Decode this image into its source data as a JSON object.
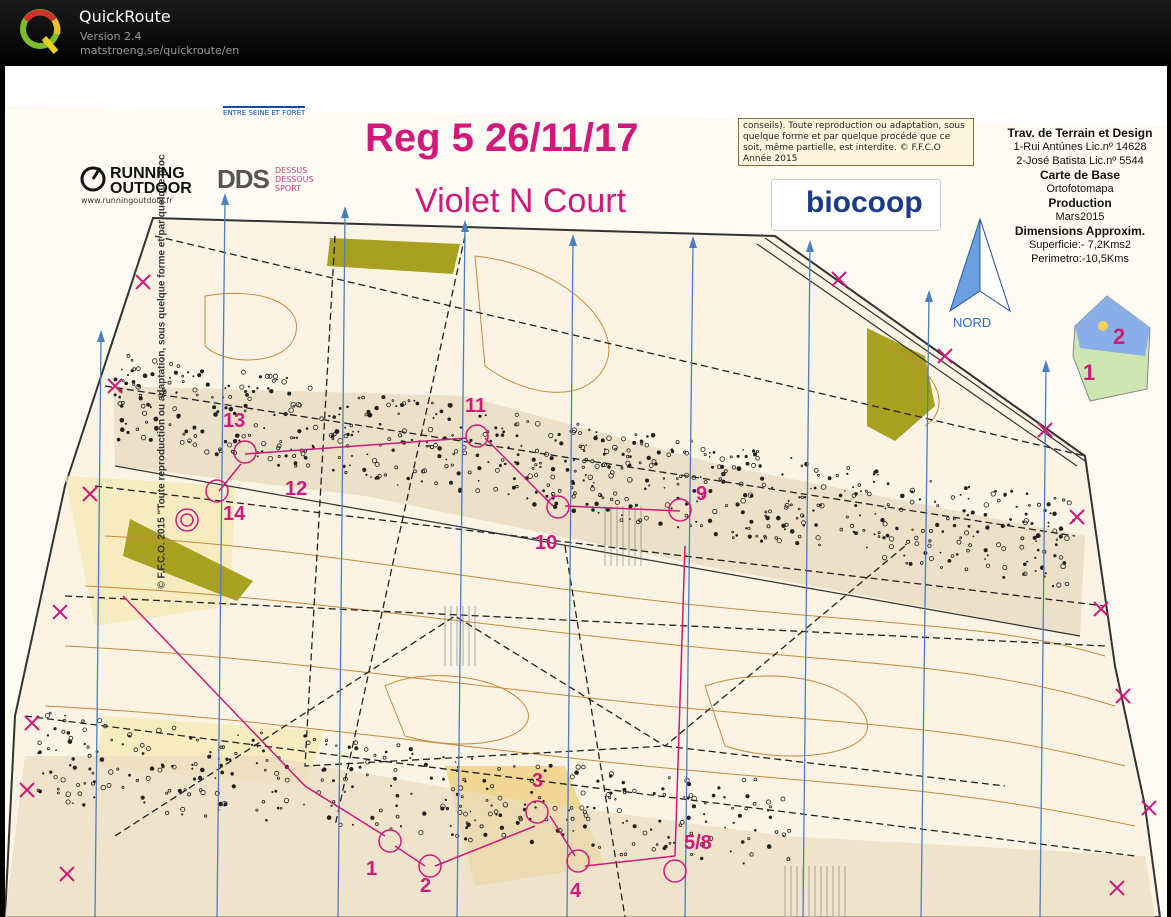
{
  "window": {
    "app_title": "QuickRoute",
    "version": "Version 2.4",
    "url": "matstroeng.se/quickroute/en"
  },
  "map": {
    "heading": "Reg 5  26/11/17",
    "course_name": "Violet N Court",
    "copyright_box": "conseils). Toute reproduction ou adaptation, sous quelque forme et par quelque procédé que ce soit, même partielle, est interdite. © F.F.C.O Année 2015",
    "side_copyright": "© F.F.C.O. 2015  \"Toute reproduction ou adaptation, sous quelque forme et par quelque proc",
    "sponsor_running": "RUNNING\nOUTDOOR",
    "sponsor_running_url": "www.runningoutdoor.fr",
    "sponsor_dds": "DDS",
    "sponsor_dds_sub": "DESSUS\nDESSOUS\nSPORT",
    "sponsor_entre": "ENTRE SEINE ET FORÊT",
    "sponsor_biocoop": "biocoop",
    "north_label": "NORD",
    "credits": {
      "title": "Trav. de Terrain et Design",
      "author1": "1-Rui Antúnes Lic.nº 14628",
      "author2": "2-José Batista Lic.nº 5544",
      "base_title": "Carte de Base",
      "base_value": "Ortofotomapa",
      "production_title": "Production",
      "production_value": "Mars2015",
      "dims_title": "Dimensions Approxim.",
      "surface": "Superficie:- 7,2Kms2",
      "perimeter": "Perimetro:-10,5Kms"
    },
    "inset_labels": [
      "2",
      "1"
    ],
    "control_numbers": [
      "13",
      "11",
      "12",
      "9",
      "14",
      "10",
      "3",
      "5/8",
      "1",
      "2",
      "4"
    ]
  },
  "colors": {
    "course": "#d0197a",
    "north_lines": "#4a7fc0",
    "contour": "#c8893a",
    "green_area": "#a8a020"
  }
}
